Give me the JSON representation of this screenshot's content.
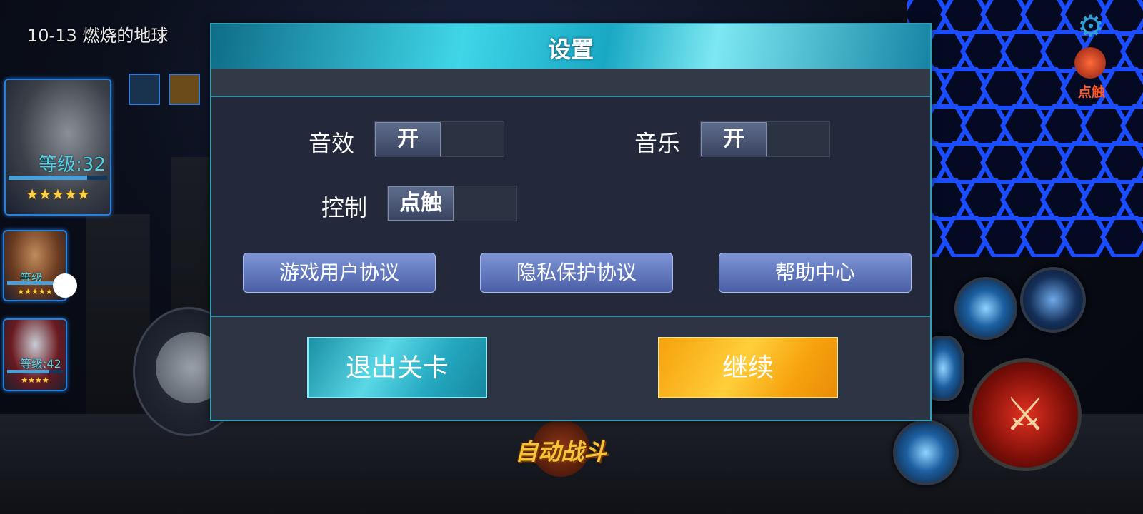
{
  "stage": {
    "title": "10-13 燃烧的地球"
  },
  "heroes": [
    {
      "level": "等级:32",
      "stars": "★★★★★",
      "bar_fraction": 0.8
    },
    {
      "level": "等级",
      "stars": "★★★★★",
      "bar_fraction": 0.9
    },
    {
      "level": "等级:42",
      "stars": "★★★★",
      "bar_fraction": 0.75
    }
  ],
  "hud": {
    "control_toggle_label": "点触",
    "auto_battle_label": "自动战斗",
    "icons": {
      "settings": "gear-icon",
      "attack": "crossed-swords-icon"
    }
  },
  "dialog": {
    "title": "设置",
    "settings": {
      "sound_effects": {
        "label": "音效",
        "value": "开"
      },
      "music": {
        "label": "音乐",
        "value": "开"
      },
      "control": {
        "label": "控制",
        "value": "点触"
      }
    },
    "links": {
      "user_agreement": "游戏用户协议",
      "privacy_agreement": "隐私保护协议",
      "help_center": "帮助中心"
    },
    "buttons": {
      "exit_stage": "退出关卡",
      "continue": "继续"
    }
  },
  "colors": {
    "dialog_bg": "#23293a",
    "header_accent": "#3fd6e8",
    "exit_button": "#23a8c0",
    "continue_button": "#f7a20e",
    "link_button": "#5a6fb6"
  }
}
